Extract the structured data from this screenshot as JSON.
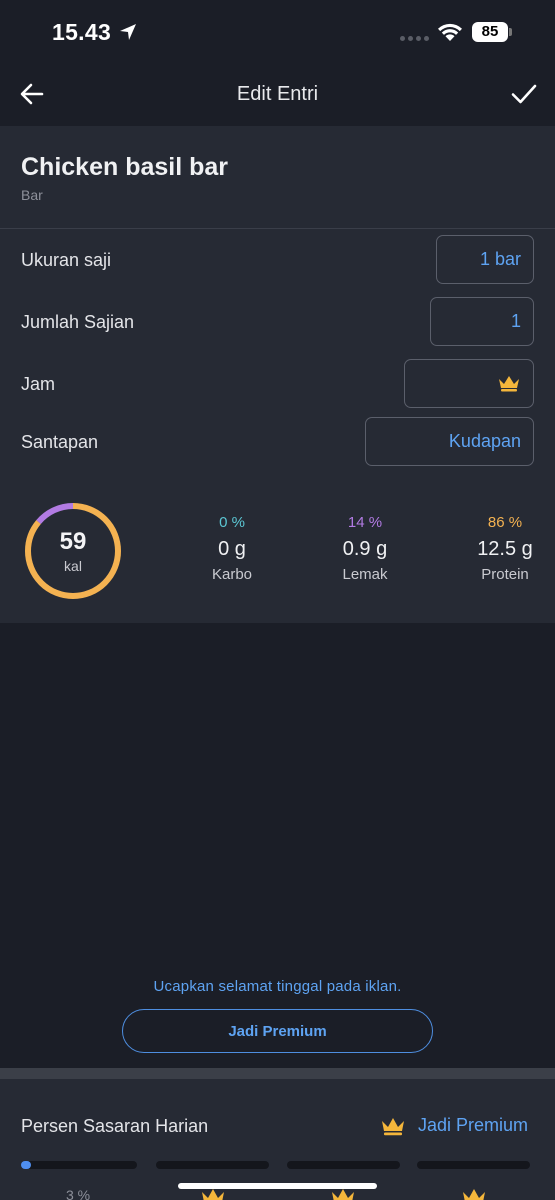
{
  "status_bar": {
    "time": "15.43",
    "battery": "85"
  },
  "app_bar": {
    "title": "Edit Entri"
  },
  "food": {
    "name": "Chicken basil bar",
    "subtitle": "Bar"
  },
  "fields": [
    {
      "label": "Ukuran saji",
      "value": "1 bar"
    },
    {
      "label": "Jumlah Sajian",
      "value": "1"
    },
    {
      "label": "Jam",
      "value": ""
    },
    {
      "label": "Santapan",
      "value": "Kudapan"
    }
  ],
  "nutrition": {
    "calories": "59",
    "calories_unit": "kal",
    "macros": [
      {
        "pct": "0 %",
        "value": "0 g",
        "label": "Karbo",
        "color": "#5cc7d4"
      },
      {
        "pct": "14 %",
        "value": "0.9 g",
        "label": "Lemak",
        "color": "#b27be3"
      },
      {
        "pct": "86 %",
        "value": "12.5 g",
        "label": "Protein",
        "color": "#f4b251"
      }
    ],
    "ring_fractions": {
      "carb": 0,
      "fat": 0.14,
      "protein": 0.86
    }
  },
  "ad": {
    "text": "Ucapkan selamat tinggal pada iklan.",
    "button": "Jadi Premium"
  },
  "daily_goal": {
    "title": "Persen Sasaran Harian",
    "premium_label": "Jadi Premium",
    "first_pct": "3 %",
    "first_fraction": 0.03
  },
  "colors": {
    "accent": "#5ea3f2",
    "crown": "#f4b63b"
  }
}
